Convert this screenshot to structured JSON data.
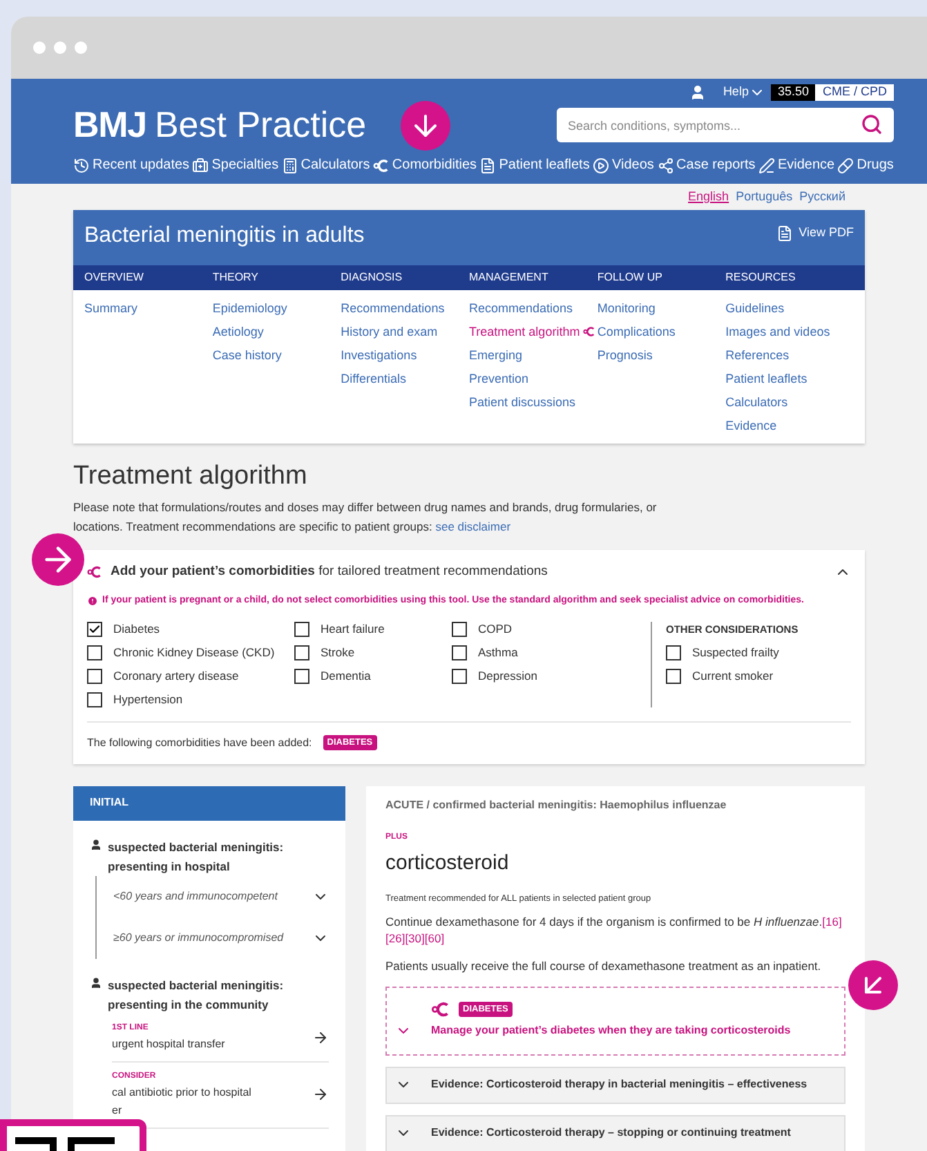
{
  "header": {
    "logo_bold": "BMJ",
    "logo_text": "Best Practice",
    "help": "Help",
    "cme_points": "35.50",
    "cme_label": "CME / CPD",
    "search": {
      "placeholder": "Search conditions, symptoms..."
    },
    "nav": [
      {
        "label": "Recent updates",
        "kind": "history"
      },
      {
        "label": "Specialties",
        "kind": "kit"
      },
      {
        "label": "Calculators",
        "kind": "calculator"
      },
      {
        "label": "Comorbidities",
        "kind": "comorbidity"
      },
      {
        "label": "Patient leaflets",
        "kind": "leaflet"
      },
      {
        "label": "Videos",
        "kind": "video"
      },
      {
        "label": "Case reports",
        "kind": "network"
      },
      {
        "label": "Evidence",
        "kind": "evidence"
      },
      {
        "label": "Drugs",
        "kind": "pill"
      }
    ]
  },
  "languages": [
    {
      "label": "English",
      "selected": true
    },
    {
      "label": "Português",
      "selected": false
    },
    {
      "label": "Русский",
      "selected": false
    }
  ],
  "topic": {
    "title": "Bacterial meningitis in adults",
    "pdf": "View PDF",
    "sections": [
      {
        "heading": "OVERVIEW",
        "links": [
          {
            "label": "Summary",
            "selected": false
          }
        ]
      },
      {
        "heading": "THEORY",
        "links": [
          {
            "label": "Epidemiology",
            "selected": false
          },
          {
            "label": "Aetiology",
            "selected": false
          },
          {
            "label": "Case history",
            "selected": false
          }
        ]
      },
      {
        "heading": "DIAGNOSIS",
        "links": [
          {
            "label": "Recommendations",
            "selected": false
          },
          {
            "label": "History and exam",
            "selected": false
          },
          {
            "label": "Investigations",
            "selected": false
          },
          {
            "label": "Differentials",
            "selected": false
          }
        ]
      },
      {
        "heading": "MANAGEMENT",
        "links": [
          {
            "label": "Recommendations",
            "selected": false
          },
          {
            "label": "Treatment algorithm",
            "selected": true
          },
          {
            "label": "Emerging",
            "selected": false
          },
          {
            "label": "Prevention",
            "selected": false
          },
          {
            "label": "Patient discussions",
            "selected": false
          }
        ]
      },
      {
        "heading": "FOLLOW UP",
        "links": [
          {
            "label": "Monitoring",
            "selected": false
          },
          {
            "label": "Complications",
            "selected": false
          },
          {
            "label": "Prognosis",
            "selected": false
          }
        ]
      },
      {
        "heading": "RESOURCES",
        "links": [
          {
            "label": "Guidelines",
            "selected": false
          },
          {
            "label": "Images and videos",
            "selected": false
          },
          {
            "label": "References",
            "selected": false
          },
          {
            "label": "Patient leaflets",
            "selected": false
          },
          {
            "label": "Calculators",
            "selected": false
          },
          {
            "label": "Evidence",
            "selected": false
          }
        ]
      }
    ]
  },
  "algorithm": {
    "title": "Treatment algorithm",
    "note": "Please note that formulations/routes and doses may differ between drug names and brands, drug formularies, or locations. Treatment recommendations are specific to patient groups:",
    "disclaimer_link": "see disclaimer"
  },
  "comorbidities": {
    "heading": "**Add your patient’s comorbidities** for tailored treatment recommendations",
    "expanded": true,
    "warning": "If your patient is pregnant or a child, do not select comorbidities using this tool. Use the standard algorithm and seek specialist advice on comorbidities.",
    "columns": [
      [
        {
          "label": "Diabetes",
          "checked": true
        },
        {
          "label": "Chronic Kidney Disease (CKD)",
          "checked": false
        },
        {
          "label": "Coronary artery disease",
          "checked": false
        },
        {
          "label": "Hypertension",
          "checked": false
        }
      ],
      [
        {
          "label": "Heart failure",
          "checked": false
        },
        {
          "label": "Stroke",
          "checked": false
        },
        {
          "label": "Dementia",
          "checked": false
        }
      ],
      [
        {
          "label": "COPD",
          "checked": false
        },
        {
          "label": "Asthma",
          "checked": false
        },
        {
          "label": "Depression",
          "checked": false
        }
      ]
    ],
    "other_title": "OTHER CONSIDERATIONS",
    "other": [
      {
        "label": "Suspected frailty",
        "checked": false
      },
      {
        "label": "Current smoker",
        "checked": false
      }
    ],
    "added_label": "The following comorbidities have been added:",
    "added": [
      "DIABETES"
    ]
  },
  "initial": {
    "heading": "INITIAL",
    "groups": [
      {
        "title": "suspected bacterial meningitis: presenting in hospital",
        "subgroups": [
          "<60 years and immunocompetent",
          "≥60 years or immunocompromised"
        ]
      },
      {
        "title": "suspected bacterial meningitis: presenting in the community",
        "options": [
          {
            "tag": "1ST LINE",
            "lines": [
              "urgent hospital transfer"
            ]
          },
          {
            "tag": "CONSIDER",
            "lines": [
              "cal antibiotic prior to hospital",
              "er"
            ]
          }
        ]
      }
    ]
  },
  "detail": {
    "breadcrumb": "ACUTE / confirmed bacterial meningitis: Haemophilus influenzae",
    "tag": "PLUS",
    "title": "corticosteroid",
    "note": "Treatment recommended for ALL patients in selected patient group",
    "paragraph": "Continue dexamethasone for 4 days if the organism is confirmed to be *H influenzae*.",
    "refs": [
      "[16]",
      "[26]",
      "[30]",
      "[60]"
    ],
    "paragraph2": "Patients usually receive the full course of dexamethasone treatment as an inpatient.",
    "comorbidity_box": {
      "tag": "DIABETES",
      "text": "Manage your patient’s diabetes when they are taking corticosteroids",
      "expanded": false
    },
    "evidence": [
      {
        "label": "Evidence: Corticosteroid therapy in bacterial meningitis – effectiveness",
        "expanded": false
      },
      {
        "label": "Evidence: Corticosteroid therapy – stopping or continuing treatment",
        "expanded": false
      }
    ]
  }
}
